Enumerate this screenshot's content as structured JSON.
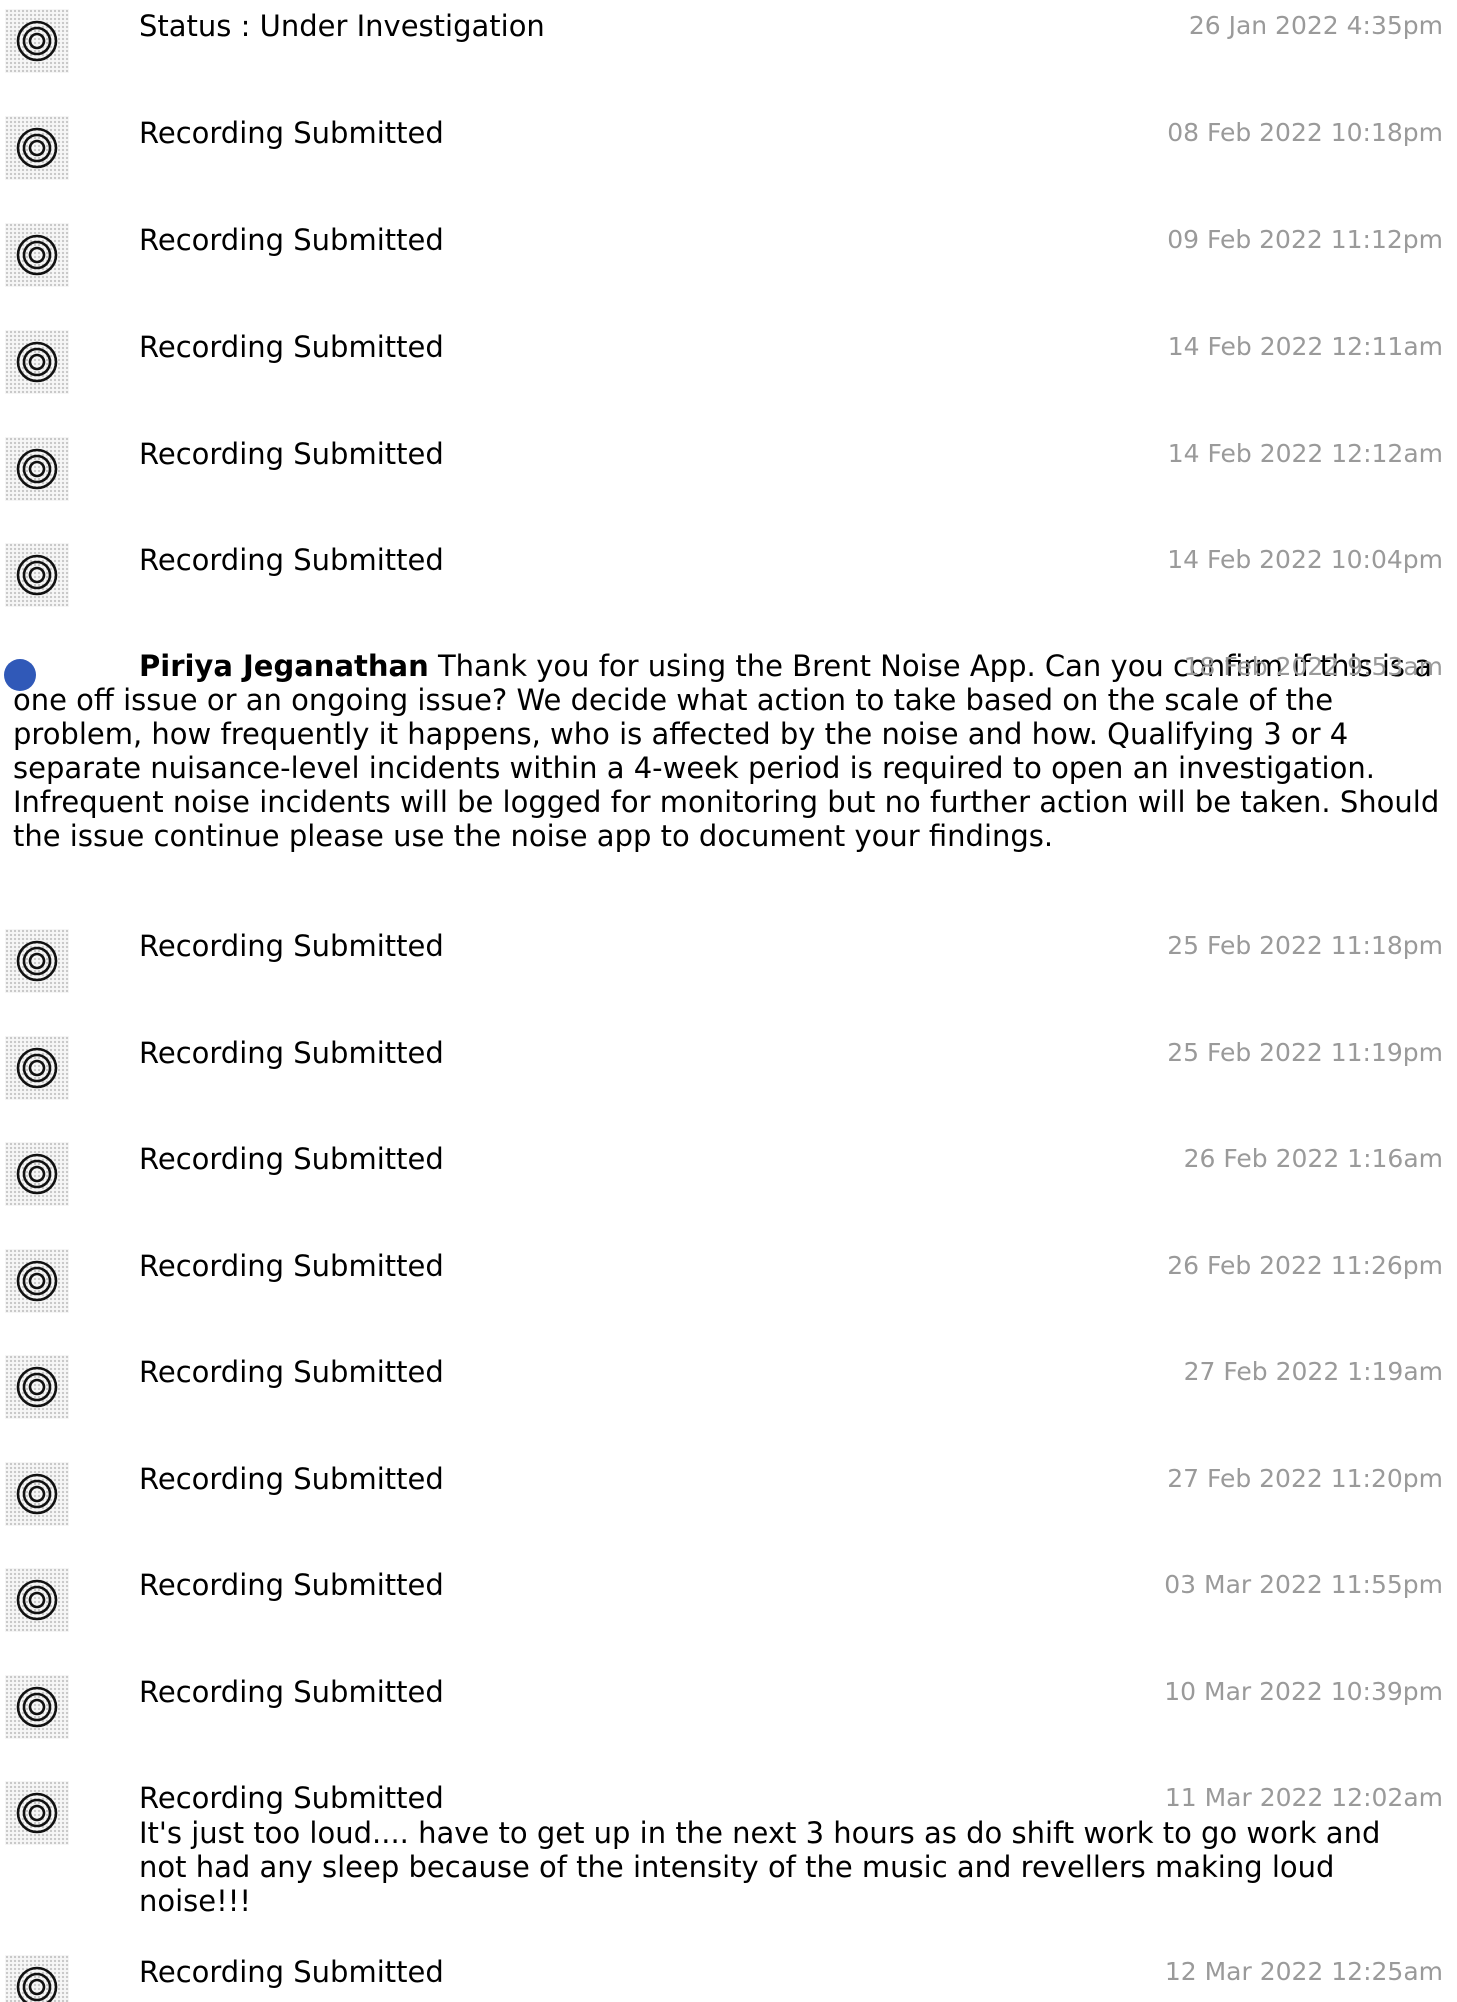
{
  "icons": {
    "recording_avatar": "concentric-circles-icon",
    "staff_avatar": "blue-dot"
  },
  "colors": {
    "timestamp": "#9a9a9a",
    "staff_dot": "#3059b8"
  },
  "entries": [
    {
      "type": "event",
      "title": "Status : Under Investigation",
      "time": "26 Jan 2022 4:35pm"
    },
    {
      "type": "event",
      "title": "Recording Submitted",
      "time": "08 Feb 2022 10:18pm"
    },
    {
      "type": "event",
      "title": "Recording Submitted",
      "time": "09 Feb 2022 11:12pm"
    },
    {
      "type": "event",
      "title": "Recording Submitted",
      "time": "14 Feb 2022 12:11am"
    },
    {
      "type": "event",
      "title": "Recording Submitted",
      "time": "14 Feb 2022 12:12am"
    },
    {
      "type": "event",
      "title": "Recording Submitted",
      "time": "14 Feb 2022 10:04pm"
    },
    {
      "type": "message",
      "author": "Piriya Jeganathan",
      "text": "Thank you for using the Brent Noise App. Can you confirm if this is a one off issue or an ongoing issue? We decide what action to take based on the scale of the problem, how frequently it happens, who is affected by the noise and how. Qualifying 3 or 4 separate nuisance-level incidents within a 4-week period is required to open an investigation. Infrequent noise incidents will be logged for monitoring but no further action will be taken. Should the issue continue please use the noise app to document your findings.",
      "time": "18 Feb 2022 9:53am"
    },
    {
      "type": "event",
      "title": "Recording Submitted",
      "time": "25 Feb 2022 11:18pm"
    },
    {
      "type": "event",
      "title": "Recording Submitted",
      "time": "25 Feb 2022 11:19pm"
    },
    {
      "type": "event",
      "title": "Recording Submitted",
      "time": "26 Feb 2022 1:16am"
    },
    {
      "type": "event",
      "title": "Recording Submitted",
      "time": "26 Feb 2022 11:26pm"
    },
    {
      "type": "event",
      "title": "Recording Submitted",
      "time": "27 Feb 2022 1:19am"
    },
    {
      "type": "event",
      "title": "Recording Submitted",
      "time": "27 Feb 2022 11:20pm"
    },
    {
      "type": "event",
      "title": "Recording Submitted",
      "time": "03 Mar 2022 11:55pm"
    },
    {
      "type": "event",
      "title": "Recording Submitted",
      "time": "10 Mar 2022 10:39pm"
    },
    {
      "type": "event",
      "title": "Recording Submitted",
      "time": "11 Mar 2022 12:02am",
      "note": "It's just too loud.... have to get up in the next 3 hours as do shift work to go work and not had any sleep because of the intensity of the music and revellers making loud noise!!!"
    },
    {
      "type": "event",
      "title": "Recording Submitted",
      "time": "12 Mar 2022 12:25am"
    }
  ]
}
